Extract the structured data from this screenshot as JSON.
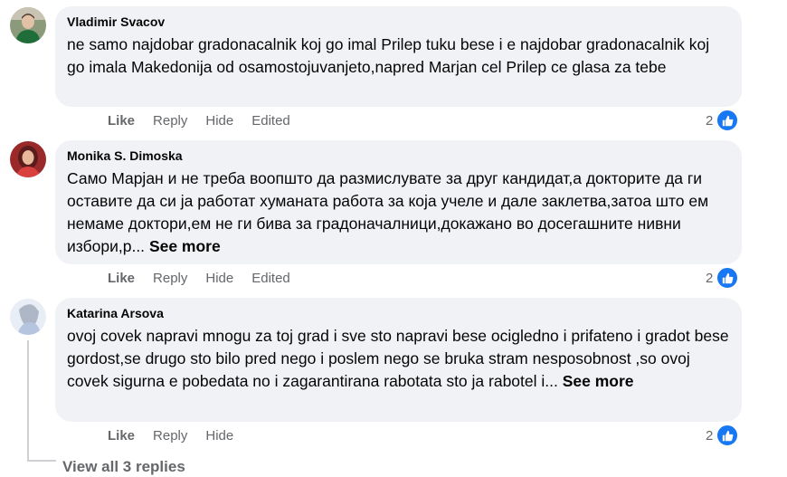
{
  "comments": [
    {
      "author": "Vladimir Svacov",
      "text": "ne samo najdobar gradonacalnik koj go imal Prilep tuku bese i e najdobar gradonacalnik koj go imala Makedonija od osamostojuvanjeto,napred Marjan cel Prilep ce glasa za tebe",
      "see_more": "",
      "actions": {
        "like": "Like",
        "reply": "Reply",
        "hide": "Hide",
        "edited": "Edited"
      },
      "reaction_count": "2"
    },
    {
      "author": "Monika S. Dimoska",
      "text": "Само Марјан и не треба воопшто да размислувате за друг кандидат,а докторите да ги оставите да си ја работат хуманата работа за која учеле и дале заклетва,затоа што ем немаме доктори,ем не ги бива за градоначалници,докажано во досегашните нивни избори,р...",
      "see_more": "See more",
      "actions": {
        "like": "Like",
        "reply": "Reply",
        "hide": "Hide",
        "edited": "Edited"
      },
      "reaction_count": "2"
    },
    {
      "author": "Katarina Arsova",
      "text": "ovoj covek napravi mnogu za toj grad i sve sto napravi bese ocigledno i prifateno i gradot bese gordost,se drugo sto bilo pred nego i poslem nego se bruka stram nesposobnost ,so ovoj covek sigurna e pobedata no i zagarantirana rabotata sto ja rabotel i...",
      "see_more": "See more",
      "actions": {
        "like": "Like",
        "reply": "Reply",
        "hide": "Hide"
      },
      "reaction_count": "2"
    }
  ],
  "view_replies": "View all 3 replies",
  "colors": {
    "bubble": "#f0f2f5",
    "secondary_text": "#65676b",
    "like_blue": "#1877f2"
  },
  "icons": [
    "thumbs-up-icon",
    "avatar"
  ]
}
